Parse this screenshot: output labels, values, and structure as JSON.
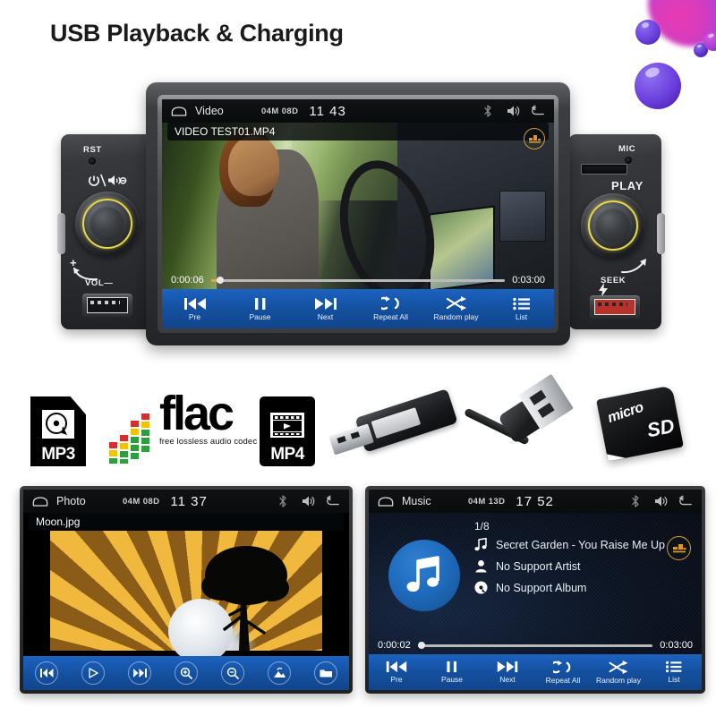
{
  "title": "USB Playback & Charging",
  "colors": {
    "control_bar_blue": "#14509f",
    "accent_orange": "#e8a23c",
    "knob_ring_yellow": "#e8d84a",
    "charge_port_red": "#b7322a",
    "sphere_purple": "#6b3fdd"
  },
  "main_unit": {
    "left_panel": {
      "reset_label": "RST",
      "power_mute_icon": "power-mute-icon",
      "volume_plus": "+",
      "volume_label": "VOL",
      "volume_minus": "—",
      "usb_port": "usb-port-playback"
    },
    "right_panel": {
      "mic_label": "MIC",
      "sd_slot": "micro-sd-slot",
      "play_label": "PLAY",
      "seek_label": "SEEK",
      "charge_port": "usb-port-charging"
    },
    "screen": {
      "statusbar": {
        "home_icon": "home-icon",
        "source": "Video",
        "date": "04M 08D",
        "time": "11 43",
        "bluetooth_icon": "bluetooth-icon",
        "volume_icon": "volume-icon",
        "back_icon": "back-arrow-icon"
      },
      "file_name": "VIDEO TEST01.MP4",
      "eq_icon": "equalizer-icon",
      "elapsed": "0:00:06",
      "duration": "0:03:00",
      "progress_percent": 3,
      "controls": [
        {
          "label": "Pre",
          "icon": "previous-icon"
        },
        {
          "label": "Pause",
          "icon": "pause-icon"
        },
        {
          "label": "Next",
          "icon": "next-icon"
        },
        {
          "label": "Repeat All",
          "icon": "repeat-icon"
        },
        {
          "label": "Random play",
          "icon": "shuffle-icon"
        },
        {
          "label": "List",
          "icon": "list-icon"
        }
      ]
    }
  },
  "formats": {
    "mp3": "MP3",
    "flac_word": "flac",
    "flac_sub": "free lossless audio codec",
    "mp4": "MP4"
  },
  "hardware": {
    "usb_stick": "usb-flash-drive",
    "usb_cable": "usb-cable",
    "sd_card_brand": "micro",
    "sd_card_logo": "SD"
  },
  "photo_screen": {
    "statusbar": {
      "home_icon": "home-icon",
      "source": "Photo",
      "date": "04M 08D",
      "time": "11 37",
      "bluetooth_icon": "bluetooth-icon",
      "volume_icon": "volume-icon",
      "back_icon": "back-arrow-icon"
    },
    "file_name": "Moon.jpg",
    "toolbar": [
      {
        "icon": "previous-icon",
        "name": "previous-button"
      },
      {
        "icon": "play-icon",
        "name": "play-button"
      },
      {
        "icon": "next-icon",
        "name": "next-button"
      },
      {
        "icon": "zoom-in-icon",
        "name": "zoom-in-button"
      },
      {
        "icon": "zoom-out-icon",
        "name": "zoom-out-button"
      },
      {
        "icon": "rotate-image-icon",
        "name": "rotate-button"
      },
      {
        "icon": "folder-icon",
        "name": "folder-button"
      }
    ]
  },
  "music_screen": {
    "statusbar": {
      "home_icon": "home-icon",
      "source": "Music",
      "date": "04M 13D",
      "time": "17 52",
      "bluetooth_icon": "bluetooth-icon",
      "volume_icon": "volume-icon",
      "back_icon": "back-arrow-icon"
    },
    "track_index": "1/8",
    "track_title": "Secret Garden - You Raise Me Up",
    "artist": "No Support Artist",
    "album": "No Support Album",
    "eq_icon": "equalizer-icon",
    "album_art_icon": "music-note-icon",
    "elapsed": "0:00:02",
    "duration": "0:03:00",
    "progress_percent": 1,
    "controls": [
      {
        "label": "Pre",
        "icon": "previous-icon"
      },
      {
        "label": "Pause",
        "icon": "pause-icon"
      },
      {
        "label": "Next",
        "icon": "next-icon"
      },
      {
        "label": "Repeat All",
        "icon": "repeat-icon"
      },
      {
        "label": "Random play",
        "icon": "shuffle-icon"
      },
      {
        "label": "List",
        "icon": "list-icon"
      }
    ]
  }
}
